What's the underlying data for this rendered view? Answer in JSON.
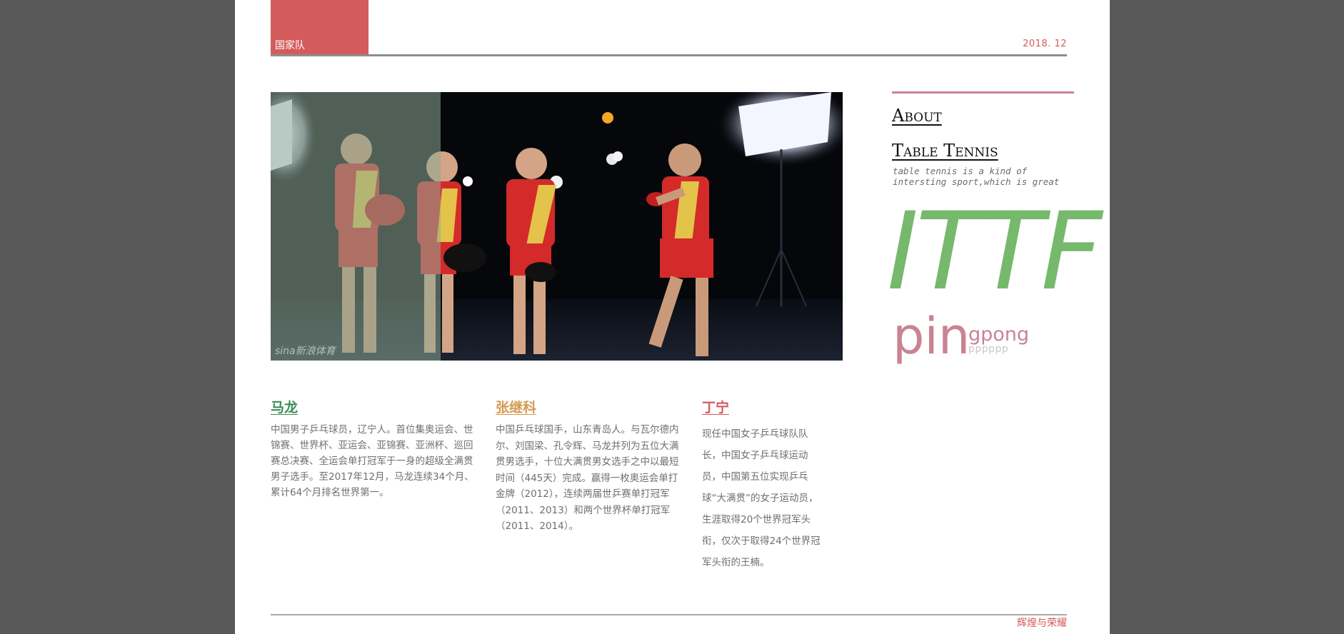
{
  "header": {
    "section_label": "国家队",
    "date": "2018. 12",
    "accent_color": "#d45b5b"
  },
  "hero": {
    "watermark": "sina新浪体育"
  },
  "profiles": [
    {
      "name": "马龙",
      "color": "#3c8a58",
      "bio": "中国男子乒乓球员，辽宁人。首位集奥运会、世锦赛、世界杯、亚运会、亚锦赛、亚洲杯、巡回赛总决赛、全运会单打冠军于一身的超级全满贯男子选手。至2017年12月，马龙连续34个月、累计64个月排名世界第一。"
    },
    {
      "name": "张继科",
      "color": "#d39a52",
      "bio": "中国乒乓球国手，山东青岛人。与瓦尔德内尔、刘国梁、孔令辉、马龙并列为五位大满贯男选手，十位大满贯男女选手之中以最短时间（445天）完成。赢得一枚奥运会单打金牌（2012），连续两届世乒赛单打冠军（2011、2013）和两个世界杯单打冠军（2011、2014）。"
    },
    {
      "name": "丁宁",
      "color": "#d45b5b",
      "bio": "现任中国女子乒乓球队队长，中国女子乒乓球运动员，中国第五位实现乒乓球“大满贯”的女子运动员，生涯取得20个世界冠军头衔，仅次于取得24个世界冠军头衔的王楠。"
    }
  ],
  "sidebar": {
    "title_line1": "About",
    "title_line2": "Table Tennis",
    "description": "table tennis is a kind of intersting sport,which is great",
    "big_word": "ITTF",
    "ping_big": "pin",
    "ping_small": "gpong",
    "ping_faint": "pppppp",
    "green": "#76b96c",
    "pink": "#c98392"
  },
  "footer": {
    "text": "辉煌与荣耀"
  }
}
